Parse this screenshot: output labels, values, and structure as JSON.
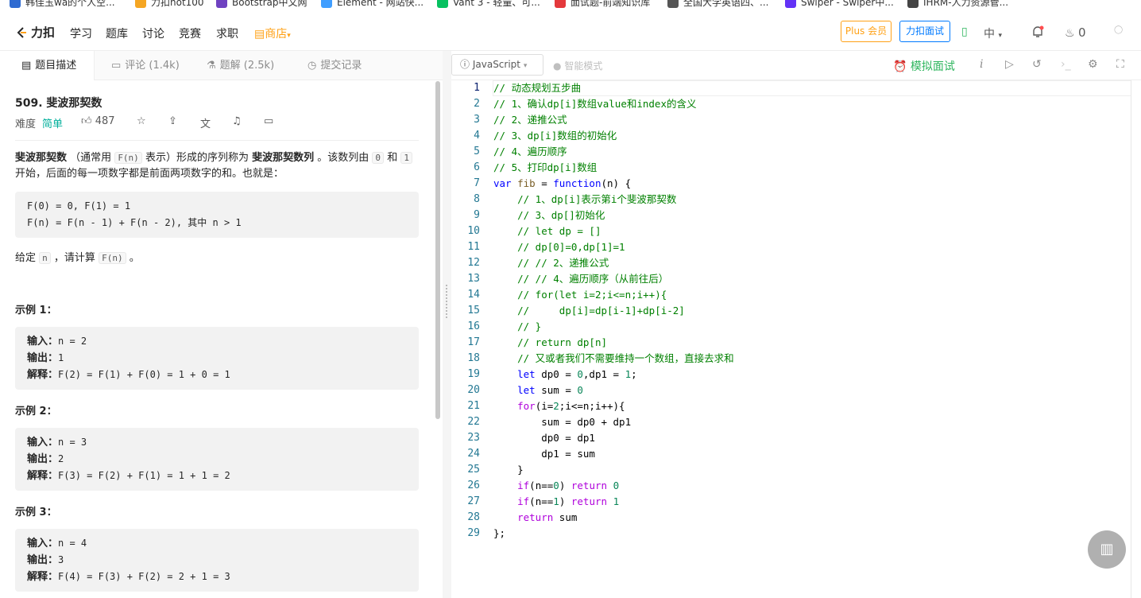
{
  "bookmarks": [
    {
      "label": "韩佳玉wa的个人空...",
      "color": "#2f6bd1"
    },
    {
      "label": "力扣hot100",
      "color": "#f5a623"
    },
    {
      "label": "Bootstrap中文网",
      "color": "#6f42c1"
    },
    {
      "label": "Element - 网站快...",
      "color": "#409eff"
    },
    {
      "label": "Vant 3 - 轻量、可...",
      "color": "#07c160"
    },
    {
      "label": "面试题-前端知识库",
      "color": "#e4393c"
    },
    {
      "label": "全国大学英语四、...",
      "color": "#555555"
    },
    {
      "label": "Swiper - Swiper中...",
      "color": "#6332f6"
    },
    {
      "label": "IHRM-人力资源管...",
      "color": "#444444"
    }
  ],
  "topnav": {
    "logo": "力扣",
    "items": [
      "学习",
      "题库",
      "讨论",
      "竞赛",
      "求职"
    ],
    "shop": "商店",
    "plus": "Plus 会员",
    "interview": "力扣面试",
    "lang": "中",
    "fire_count": "0"
  },
  "tabs": {
    "desc": "题目描述",
    "comments": "评论 (1.4k)",
    "solutions": "题解 (2.5k)",
    "submissions": "提交记录"
  },
  "problem": {
    "title": "509. 斐波那契数",
    "difficulty_label": "难度",
    "difficulty": "简单",
    "likes": "487",
    "intro_bold1": "斐波那契数",
    "intro_a": "（通常用",
    "intro_code1": "F(n)",
    "intro_b": "表示）形成的序列称为",
    "intro_bold2": "斐波那契数列",
    "intro_c": "。该数列由",
    "intro_code2": "0",
    "intro_d": "和",
    "intro_code3": "1",
    "intro_e": "开始，后面的每一项数字都是前面两项数字的和。也就是：",
    "formula1": "F(0) = 0, F(1) = 1",
    "formula2": "F(n) = F(n - 1) + F(n - 2), 其中 n > 1",
    "given_a": "给定",
    "given_code1": "n",
    "given_b": "，请计算",
    "given_code2": "F(n)",
    "given_c": "。",
    "examples": [
      {
        "heading": "示例 1：",
        "input": "n = 2",
        "output": "1",
        "explain": "F(2) = F(1) + F(0) = 1 + 0 = 1"
      },
      {
        "heading": "示例 2：",
        "input": "n = 3",
        "output": "2",
        "explain": "F(3) = F(2) + F(1) = 1 + 1 = 2"
      },
      {
        "heading": "示例 3：",
        "input": "n = 4",
        "output": "3",
        "explain": "F(4) = F(3) + F(2) = 2 + 1 = 3"
      }
    ],
    "input_label": "输入：",
    "output_label": "输出：",
    "explain_label": "解释："
  },
  "editor": {
    "language": "JavaScript",
    "smart_mode": "智能模式",
    "mock_interview": "模拟面试",
    "current_line": 1,
    "lines": [
      [
        [
          "cmt",
          "// 动态规划五步曲"
        ]
      ],
      [
        [
          "cmt",
          "// 1、确认dp[i]数组value和index的含义"
        ]
      ],
      [
        [
          "cmt",
          "// 2、递推公式"
        ]
      ],
      [
        [
          "cmt",
          "// 3、dp[i]数组的初始化"
        ]
      ],
      [
        [
          "cmt",
          "// 4、遍历顺序"
        ]
      ],
      [
        [
          "cmt",
          "// 5、打印dp[i]数组"
        ]
      ],
      [
        [
          "kw",
          "var"
        ],
        [
          "",
          " "
        ],
        [
          "fn",
          "fib"
        ],
        [
          "",
          " = "
        ],
        [
          "kw",
          "function"
        ],
        [
          "",
          "(n) {"
        ]
      ],
      [
        [
          "",
          "    "
        ],
        [
          "cmt",
          "// 1、dp[i]表示第i个斐波那契数"
        ]
      ],
      [
        [
          "",
          "    "
        ],
        [
          "cmt",
          "// 3、dp[]初始化"
        ]
      ],
      [
        [
          "",
          "    "
        ],
        [
          "cmt",
          "// let dp = []"
        ]
      ],
      [
        [
          "",
          "    "
        ],
        [
          "cmt",
          "// dp[0]=0,dp[1]=1"
        ]
      ],
      [
        [
          "",
          "    "
        ],
        [
          "cmt",
          "// // 2、递推公式"
        ]
      ],
      [
        [
          "",
          "    "
        ],
        [
          "cmt",
          "// // 4、遍历顺序（从前往后）"
        ]
      ],
      [
        [
          "",
          "    "
        ],
        [
          "cmt",
          "// for(let i=2;i<=n;i++){"
        ]
      ],
      [
        [
          "",
          "    "
        ],
        [
          "cmt",
          "//     dp[i]=dp[i-1]+dp[i-2]"
        ]
      ],
      [
        [
          "",
          "    "
        ],
        [
          "cmt",
          "// }"
        ]
      ],
      [
        [
          "",
          "    "
        ],
        [
          "cmt",
          "// return dp[n]"
        ]
      ],
      [
        [
          "",
          "    "
        ],
        [
          "cmt",
          "// 又或者我们不需要维持一个数组，直接去求和"
        ]
      ],
      [
        [
          "",
          "    "
        ],
        [
          "kw",
          "let"
        ],
        [
          "",
          " dp0 = "
        ],
        [
          "num",
          "0"
        ],
        [
          "",
          ",dp1 = "
        ],
        [
          "num",
          "1"
        ],
        [
          "",
          ";"
        ]
      ],
      [
        [
          "",
          "    "
        ],
        [
          "kw",
          "let"
        ],
        [
          "",
          " sum = "
        ],
        [
          "num",
          "0"
        ]
      ],
      [
        [
          "",
          "    "
        ],
        [
          "kw2",
          "for"
        ],
        [
          "",
          "(i="
        ],
        [
          "num",
          "2"
        ],
        [
          "",
          ";i<=n;i++){"
        ]
      ],
      [
        [
          "",
          "        sum = dp0 + dp1"
        ]
      ],
      [
        [
          "",
          "        dp0 = dp1"
        ]
      ],
      [
        [
          "",
          "        dp1 = sum"
        ]
      ],
      [
        [
          "",
          "    }"
        ]
      ],
      [
        [
          "",
          "    "
        ],
        [
          "kw2",
          "if"
        ],
        [
          "",
          "(n=="
        ],
        [
          "num",
          "0"
        ],
        [
          "",
          ") "
        ],
        [
          "kw2",
          "return"
        ],
        [
          "",
          " "
        ],
        [
          "num",
          "0"
        ]
      ],
      [
        [
          "",
          "    "
        ],
        [
          "kw2",
          "if"
        ],
        [
          "",
          "(n=="
        ],
        [
          "num",
          "1"
        ],
        [
          "",
          ") "
        ],
        [
          "kw2",
          "return"
        ],
        [
          "",
          " "
        ],
        [
          "num",
          "1"
        ]
      ],
      [
        [
          "",
          "    "
        ],
        [
          "kw2",
          "return"
        ],
        [
          "",
          " sum"
        ]
      ],
      [
        [
          "",
          "};"
        ]
      ]
    ]
  },
  "colors": {
    "accent": "#ffa116",
    "easy": "#00af9b",
    "mock": "#2db55d",
    "blue": "#007aff"
  }
}
